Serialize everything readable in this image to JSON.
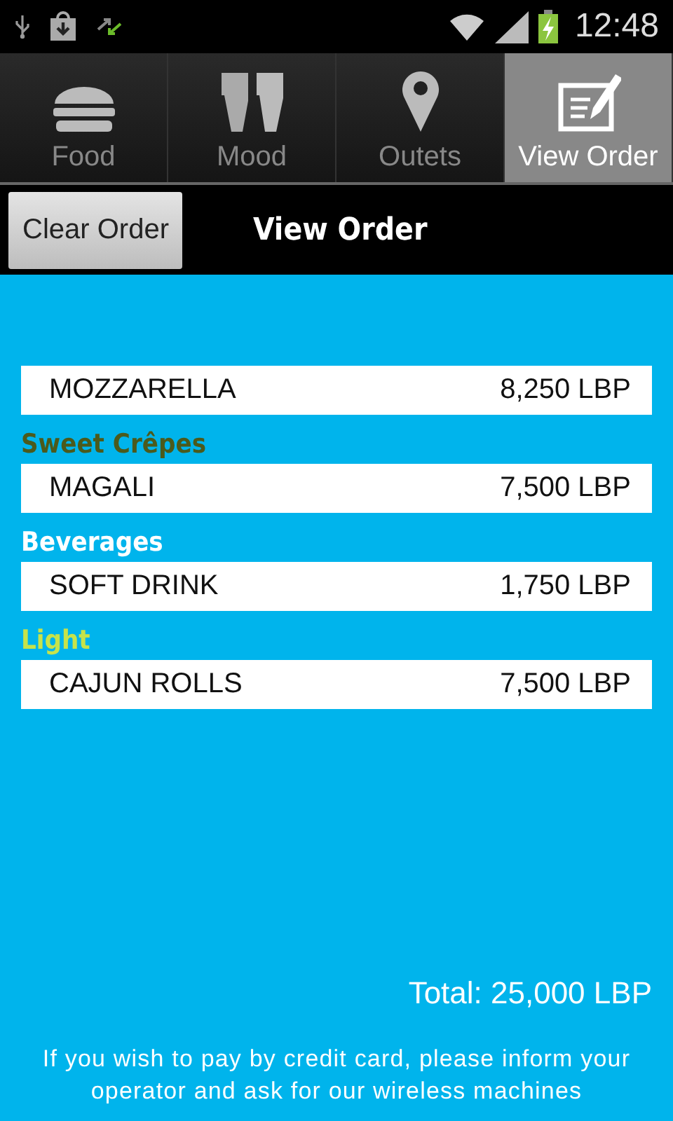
{
  "status_bar": {
    "time": "12:48",
    "battery_charging": true
  },
  "tabs": [
    {
      "label": "Food",
      "kind": "burger",
      "selected": false
    },
    {
      "label": "Mood",
      "kind": "quote",
      "selected": false
    },
    {
      "label": "Outets",
      "kind": "pin",
      "selected": false
    },
    {
      "label": "View Order",
      "kind": "note",
      "selected": true
    }
  ],
  "header": {
    "button": "Clear Order",
    "title": "View Order"
  },
  "sections": [
    {
      "items": [
        {
          "name": "MOZZARELLA",
          "price": "8,250 LBP"
        }
      ]
    },
    {
      "title": "Sweet Crêpes",
      "color": "#4b5a1c",
      "items": [
        {
          "name": "MAGALI",
          "price": "7,500 LBP"
        }
      ]
    },
    {
      "title": "Beverages",
      "color": "#ffffff",
      "items": [
        {
          "name": "SOFT DRINK",
          "price": "1,750 LBP"
        }
      ]
    },
    {
      "title": "Light",
      "color": "#c6e34a",
      "items": [
        {
          "name": "CAJUN ROLLS",
          "price": "7,500 LBP"
        }
      ]
    }
  ],
  "total": "Total: 25,000 LBP",
  "note": "If you wish to pay by credit card, please inform your operator and ask for our wireless machines"
}
